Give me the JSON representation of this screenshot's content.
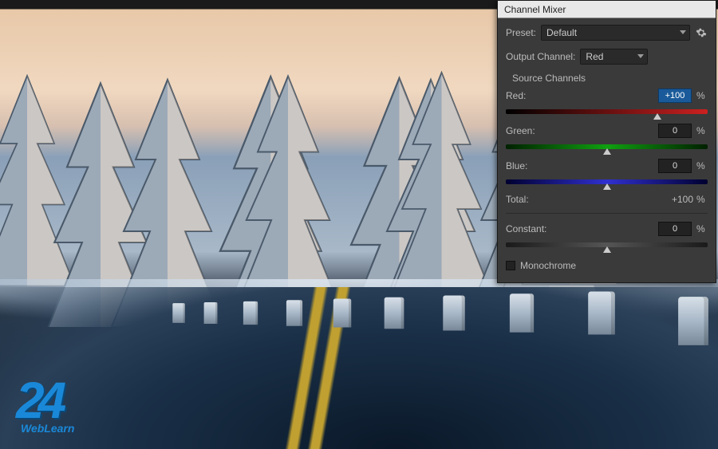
{
  "panel": {
    "title": "Channel Mixer",
    "preset_label": "Preset:",
    "preset_value": "Default",
    "output_label": "Output Channel:",
    "output_value": "Red",
    "section_label": "Source Channels",
    "channels": {
      "red": {
        "label": "Red:",
        "value": "+100",
        "pct": "%",
        "thumb_pct": 75,
        "highlight": true
      },
      "green": {
        "label": "Green:",
        "value": "0",
        "pct": "%",
        "thumb_pct": 50,
        "highlight": false
      },
      "blue": {
        "label": "Blue:",
        "value": "0",
        "pct": "%",
        "thumb_pct": 50,
        "highlight": false
      }
    },
    "total_label": "Total:",
    "total_value": "+100",
    "total_pct": "%",
    "constant_label": "Constant:",
    "constant_value": "0",
    "constant_pct": "%",
    "constant_thumb_pct": 50,
    "monochrome_label": "Monochrome",
    "monochrome_checked": false
  },
  "logo": {
    "number": "24",
    "text": "WebLearn"
  }
}
